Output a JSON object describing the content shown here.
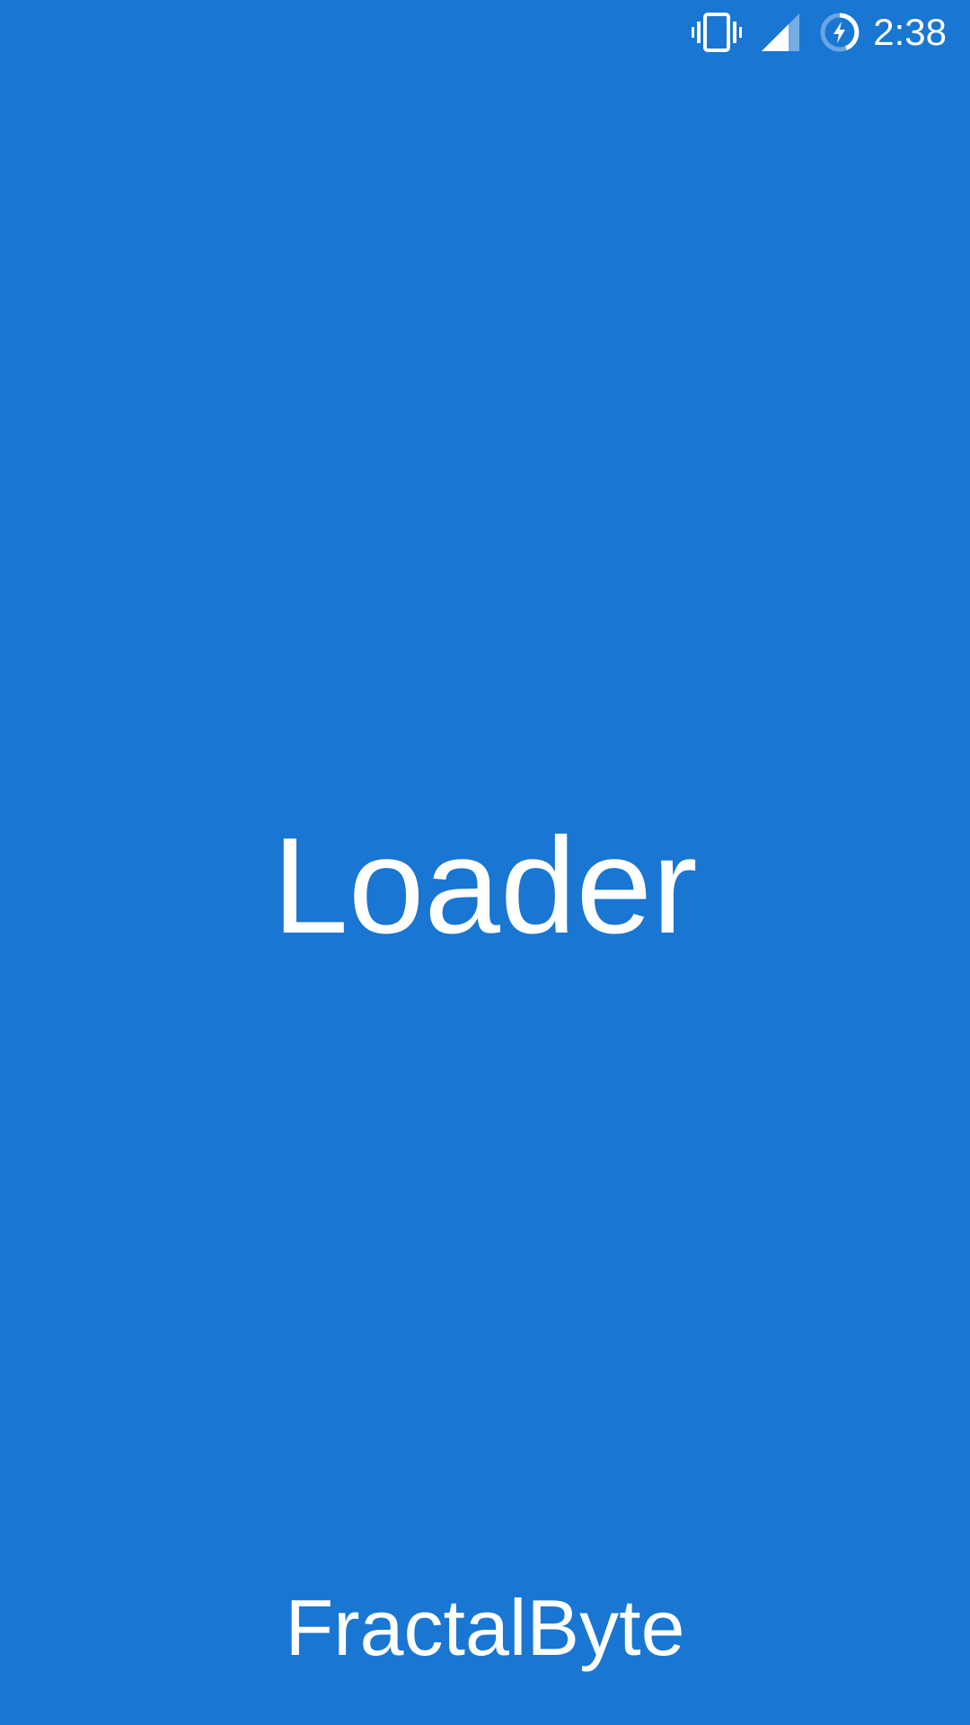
{
  "status_bar": {
    "icons": [
      "vibrate-icon",
      "cell-signal-icon",
      "battery-charging-icon"
    ],
    "time": "2:38"
  },
  "splash": {
    "title": "Loader",
    "brand": "FractalByte"
  },
  "colors": {
    "background": "#1976D2",
    "foreground": "#FFFFFF"
  }
}
